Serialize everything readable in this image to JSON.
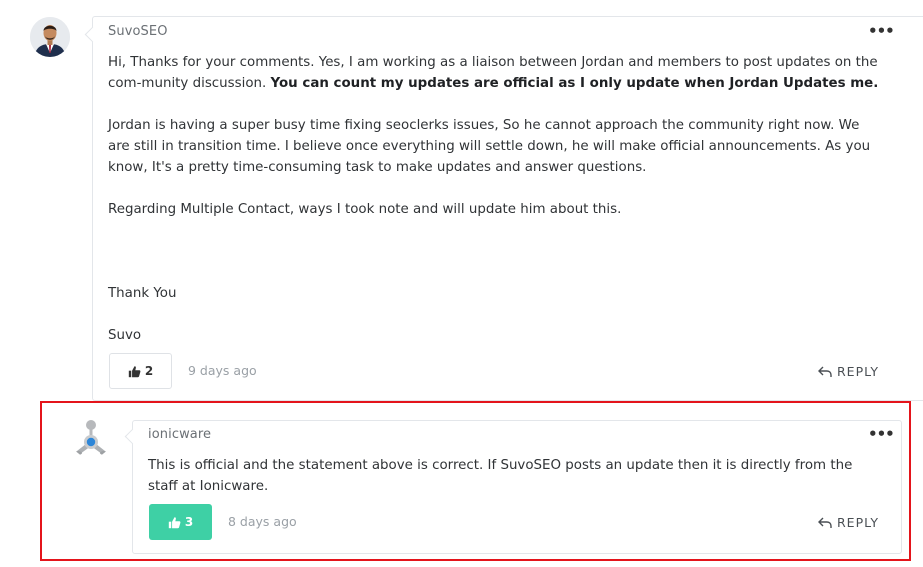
{
  "comment1": {
    "author": "SuvoSEO",
    "more_icon": "more-dots-icon",
    "paragraphs": {
      "p1_text": "Hi, Thanks for your comments. Yes, I am working as a liaison between Jordan and members to post updates on the com-munity discussion. ",
      "p1_bold": "You can count my updates are official as I only update when Jordan Updates me.",
      "p2": "Jordan is having a super busy time fixing seoclerks issues, So he cannot approach the community right now. We are still in transition time. I believe once everything will settle down, he will make official announcements. As you know, It's a pretty time-consuming task to make updates and answer questions.",
      "p3": "Regarding Multiple Contact, ways I took note and will update him about this.",
      "p4": "Thank You",
      "p5": "Suvo"
    },
    "likes": "2",
    "timestamp": "9 days ago",
    "reply_label": "REPLY"
  },
  "comment2": {
    "author": "ionicware",
    "more_icon": "more-dots-icon",
    "body": "This is official and the statement above is correct. If SuvoSEO posts an update then it is directly from the staff at Ionicware.",
    "likes": "3",
    "timestamp": "8 days ago",
    "reply_label": "REPLY"
  },
  "colors": {
    "like_active": "#3ed0a5",
    "highlight_border": "#e4141b"
  }
}
